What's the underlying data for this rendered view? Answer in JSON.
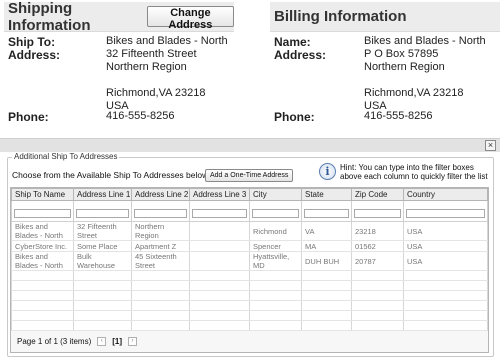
{
  "shipping": {
    "title": "Shipping Information",
    "change_button": "Change Address",
    "ship_to_label": "Ship To:",
    "ship_to_value": "Bikes and Blades - North",
    "address_label": "Address:",
    "address_line1": "32 Fifteenth Street",
    "address_line2": "Northern Region",
    "address_city_line": "Richmond,VA 23218",
    "address_country": "USA",
    "phone_label": "Phone:",
    "phone_value": "416-555-8256"
  },
  "billing": {
    "title": "Billing Information",
    "name_label": "Name:",
    "name_value": "Bikes and Blades - North",
    "address_label": "Address:",
    "address_line1": "P O Box 57895",
    "address_line2": "Northern Region",
    "address_city_line": "Richmond,VA 23218",
    "address_country": "USA",
    "phone_label": "Phone:",
    "phone_value": "416-555-8256"
  },
  "dialog": {
    "close_glyph": "×"
  },
  "additional": {
    "legend": "Additional Ship To Addresses",
    "choose_text": "Choose from the Available Ship To Addresses below, or",
    "add_button": "Add a One-Time Address",
    "info_glyph": "i",
    "hint": "Hint: You can type into the filter boxes above each column to quickly filter the list"
  },
  "grid": {
    "columns": [
      "Ship To Name",
      "Address Line 1",
      "Address Line 2",
      "Address Line 3",
      "City",
      "State",
      "Zip Code",
      "Country"
    ],
    "rows": [
      [
        "Bikes and Blades - North",
        "32 Fifteenth Street",
        "Northern Region",
        "",
        "Richmond",
        "VA",
        "23218",
        "USA"
      ],
      [
        "CyberStore Inc.",
        "Some Place",
        "Apartment Z",
        "",
        "Spencer",
        "MA",
        "01562",
        "USA"
      ],
      [
        "Bikes and Blades - North",
        "Bulk Warehouse",
        "45 Sixteenth Street",
        "",
        "Hyattsville, MD",
        "DUH BUH",
        "20787",
        "USA"
      ]
    ]
  },
  "pager": {
    "summary": "Page 1 of 1 (3 items)",
    "prev_glyph": "‹",
    "current_page": "[1]",
    "next_glyph": "›"
  }
}
